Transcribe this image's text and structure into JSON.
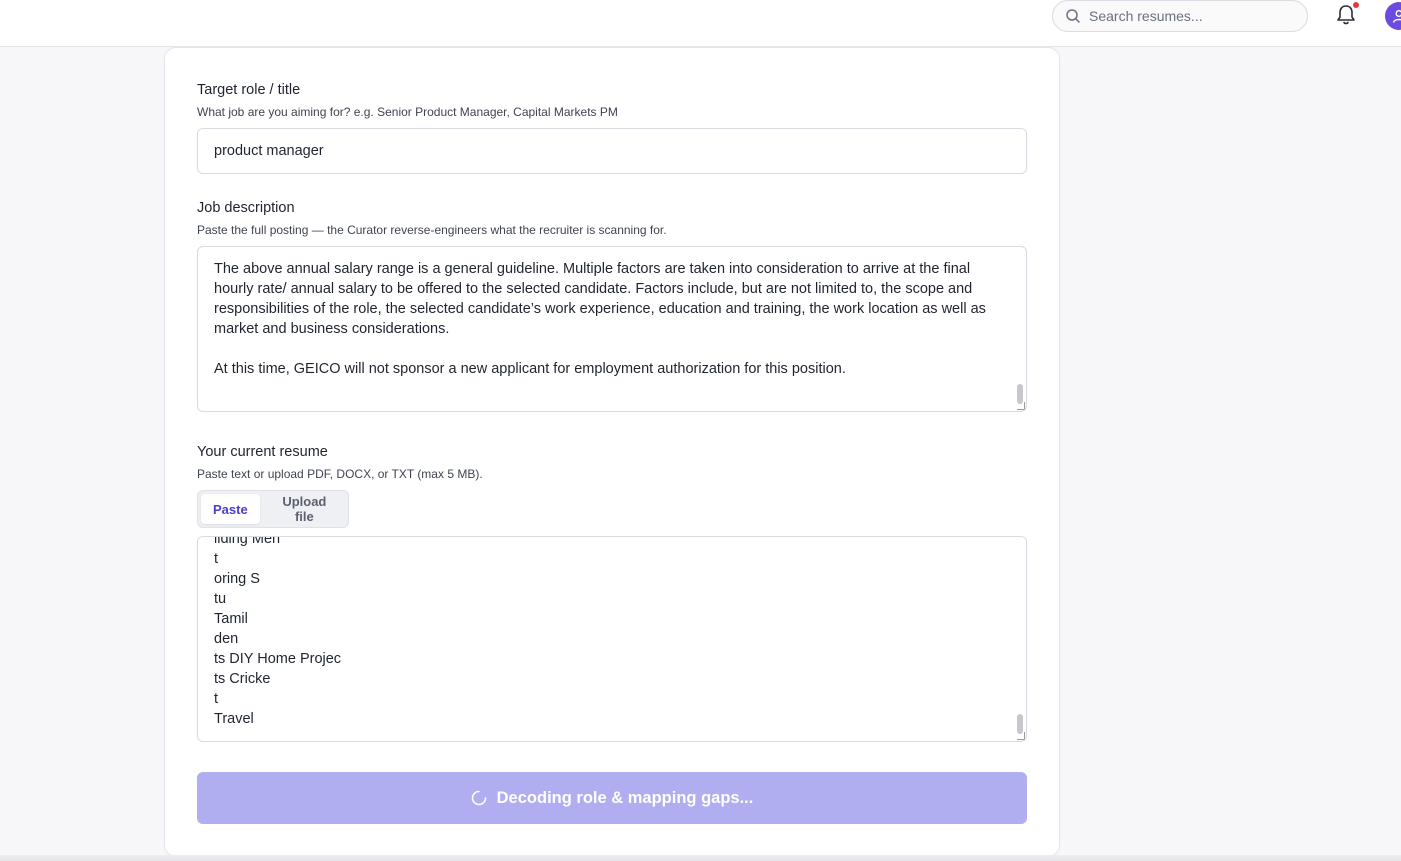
{
  "topbar": {
    "search_placeholder": "Search resumes...",
    "notification_dot_color": "#e5383b",
    "avatar_color": "#6c4ce0"
  },
  "form": {
    "target_role": {
      "label": "Target role / title",
      "help": "What job are you aiming for? e.g. Senior Product Manager, Capital Markets PM",
      "value": "product manager"
    },
    "job_description": {
      "label": "Job description",
      "help": "Paste the full posting — the Curator reverse-engineers what the recruiter is scanning for.",
      "paragraph1": "The above annual salary range is a general guideline. Multiple factors are taken into consideration to arrive at the final hourly rate/ annual salary to be offered to the selected candidate. Factors include, but are not limited to, the scope and responsibilities of the role, the selected candidate’s work experience, education and training, the work location as well as market and business considerations.",
      "paragraph2": "At this time, GEICO will not sponsor a new applicant for employment authorization for this position."
    },
    "resume": {
      "label": "Your current resume",
      "help": "Paste text or upload PDF, DOCX, or TXT (max 5 MB).",
      "tabs": [
        "Paste",
        "Upload file"
      ],
      "active_tab": "Paste",
      "lines": [
        "ilding Men",
        "t",
        "oring S",
        "tu",
        "Tamil",
        "den",
        "ts DIY Home Projec",
        "ts Cricke",
        "t",
        "Travel"
      ]
    },
    "submit_label": "Decoding role & mapping gaps...",
    "submit_color": "#b0aef0"
  }
}
